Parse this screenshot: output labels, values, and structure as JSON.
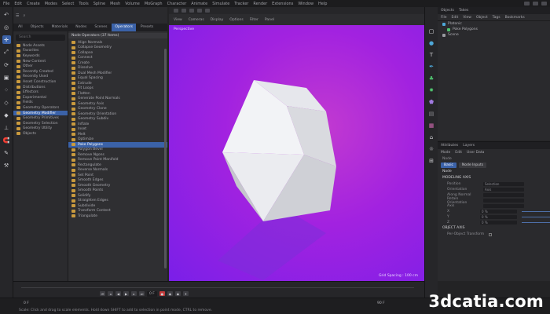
{
  "menubar": {
    "items": [
      "File",
      "Edit",
      "Create",
      "Modes",
      "Select",
      "Tools",
      "Spline",
      "Mesh",
      "Volume",
      "MoGraph",
      "Character",
      "Animate",
      "Simulate",
      "Tracker",
      "Render",
      "Extensions",
      "Window",
      "Help"
    ]
  },
  "panel": {
    "tabs": [
      "All",
      "Objects",
      "Materials",
      "Nodes",
      "Scenes",
      "Operators",
      "Presets"
    ],
    "active_tab": "Operators",
    "search_placeholder": "Search",
    "tree": [
      {
        "label": "Node Assets",
        "selected": false
      },
      {
        "label": "Favorites",
        "selected": false
      },
      {
        "label": "Keywords",
        "selected": false
      },
      {
        "label": "New Content",
        "selected": false
      },
      {
        "label": "Other",
        "selected": false
      },
      {
        "label": "Recently Created",
        "selected": false
      },
      {
        "label": "Recently Used",
        "selected": false
      },
      {
        "label": "Asset Construction",
        "selected": false
      },
      {
        "label": "Distributions",
        "selected": false
      },
      {
        "label": "Effectors",
        "selected": false
      },
      {
        "label": "Experimental",
        "selected": false
      },
      {
        "label": "Fields",
        "selected": false
      },
      {
        "label": "Geometry Operators",
        "selected": false
      },
      {
        "label": "Geometry Modifier",
        "selected": true
      },
      {
        "label": "Geometry Primitives",
        "selected": false
      },
      {
        "label": "Geometry Selection",
        "selected": false
      },
      {
        "label": "Geometry Utility",
        "selected": false
      },
      {
        "label": "Objects",
        "selected": false
      }
    ],
    "list_header": "Node Operators (37 Items)",
    "list": [
      {
        "label": "Align Normals",
        "selected": false
      },
      {
        "label": "Collapse Geometry",
        "selected": false
      },
      {
        "label": "Collapse",
        "selected": false
      },
      {
        "label": "Connect",
        "selected": false
      },
      {
        "label": "Create",
        "selected": false
      },
      {
        "label": "Dissolve",
        "selected": false
      },
      {
        "label": "Dual Mesh Modifier",
        "selected": false
      },
      {
        "label": "Equal Spacing",
        "selected": false
      },
      {
        "label": "Extrude",
        "selected": false
      },
      {
        "label": "Fit Loops",
        "selected": false
      },
      {
        "label": "Flatten",
        "selected": false
      },
      {
        "label": "Generate Point Normals",
        "selected": false
      },
      {
        "label": "Geometry Axis",
        "selected": false
      },
      {
        "label": "Geometry Clone",
        "selected": false
      },
      {
        "label": "Geometry Orientation",
        "selected": false
      },
      {
        "label": "Geometry Subdiv",
        "selected": false
      },
      {
        "label": "Inflate",
        "selected": false
      },
      {
        "label": "Inset",
        "selected": false
      },
      {
        "label": "Melt",
        "selected": false
      },
      {
        "label": "Optimize",
        "selected": false
      },
      {
        "label": "Poke Polygons",
        "selected": true
      },
      {
        "label": "Polygon Bevel",
        "selected": false
      },
      {
        "label": "Remove Ngons",
        "selected": false
      },
      {
        "label": "Remove Point Manifold",
        "selected": false
      },
      {
        "label": "Rectangulate",
        "selected": false
      },
      {
        "label": "Reverse Normals",
        "selected": false
      },
      {
        "label": "Set Point",
        "selected": false
      },
      {
        "label": "Smooth Edges",
        "selected": false
      },
      {
        "label": "Smooth Geometry",
        "selected": false
      },
      {
        "label": "Smooth Points",
        "selected": false
      },
      {
        "label": "Solidify",
        "selected": false
      },
      {
        "label": "Straighten Edges",
        "selected": false
      },
      {
        "label": "Subdivide",
        "selected": false
      },
      {
        "label": "Transform Content",
        "selected": false
      },
      {
        "label": "Triangulate",
        "selected": false
      }
    ]
  },
  "viewport": {
    "toolbar": [
      "View",
      "Cameras",
      "Display",
      "Options",
      "Filter",
      "Panel"
    ],
    "camera_label": "Perspective",
    "grid_label": "Grid Spacing : 100 cm",
    "background_top": "#c23ad0",
    "background_bottom": "#7a1fe8"
  },
  "objects_panel": {
    "tabs": [
      "Objects",
      "Takes"
    ],
    "menu": [
      "File",
      "Edit",
      "View",
      "Object",
      "Tags",
      "Bookmarks"
    ],
    "rows": [
      "Platonic",
      "Poke Polygons",
      "Scene"
    ]
  },
  "attributes_panel": {
    "tabs": [
      "Attributes",
      "Layers"
    ],
    "menu": [
      "Mode",
      "Edit",
      "User Data"
    ],
    "object_name": "Node",
    "sub_tabs": [
      "Basic",
      "Node Inputs"
    ],
    "sections": [
      "Node",
      "MODELING AXIS",
      "OBJECT AXIS"
    ],
    "fields": [
      {
        "label": "Position",
        "value": "Selection"
      },
      {
        "label": "Orientation",
        "value": "Axis"
      },
      {
        "label": "Along Normal",
        "value": ""
      },
      {
        "label": "Retain Orientation",
        "value": ""
      },
      {
        "label": "Axis",
        "value": ""
      },
      {
        "label": "X",
        "value": "0 %"
      },
      {
        "label": "Y",
        "value": "0 %"
      },
      {
        "label": "Z",
        "value": "0 %"
      }
    ],
    "checkbox_label": "Per-Object Transform"
  },
  "timeline": {
    "start_frame": "0 F",
    "end_frame": "90 F",
    "current_frame": "0 F"
  },
  "status": {
    "text": "Scale: Click and drag to scale elements. Hold down SHIFT to add to selection in point mode, CTRL to remove."
  },
  "watermark": {
    "text": "3dcatia.com"
  }
}
